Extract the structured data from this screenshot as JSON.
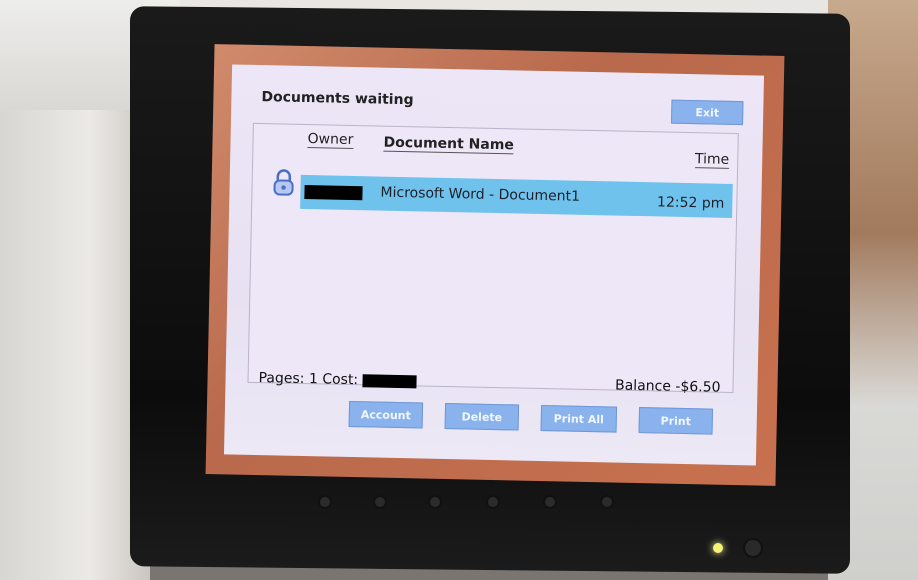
{
  "window": {
    "title": "Documents waiting"
  },
  "header_buttons": {
    "exit_label": "Exit"
  },
  "table": {
    "columns": [
      "Owner",
      "Document Name",
      "Time"
    ],
    "rows": [
      {
        "owner": "",
        "document_name": "Microsoft Word - Document1",
        "time": "12:52 pm"
      }
    ]
  },
  "summary": {
    "pages_cost_label": "Pages: 1 Cost:",
    "balance_label": "Balance -$6.50"
  },
  "footer_buttons": {
    "account_label": "Account",
    "delete_label": "Delete",
    "print_all_label": "Print All",
    "print_label": "Print"
  },
  "icons": {
    "row_icon": "lock-icon"
  },
  "colors": {
    "button_blue": "#8ab3ee",
    "selected_row": "#6fc2ec",
    "screen_border": "#c8714f"
  }
}
